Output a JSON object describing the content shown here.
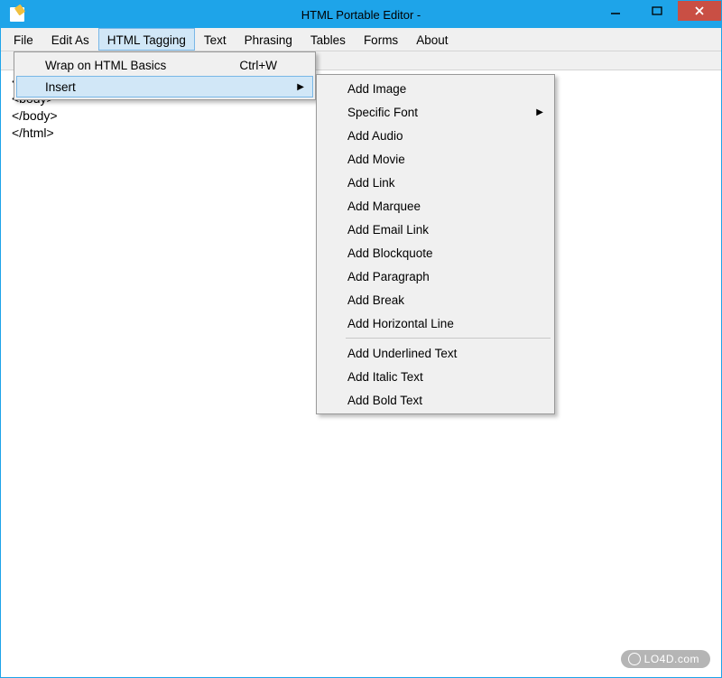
{
  "window": {
    "title": "HTML Portable Editor -"
  },
  "menubar": {
    "file": "File",
    "editas": "Edit As",
    "htmltagging": "HTML Tagging",
    "text": "Text",
    "phrasing": "Phrasing",
    "tables": "Tables",
    "forms": "Forms",
    "about": "About"
  },
  "dropdown": {
    "wrap": {
      "label": "Wrap on HTML Basics",
      "shortcut": "Ctrl+W"
    },
    "insert": {
      "label": "Insert"
    }
  },
  "submenu": {
    "addimage": "Add Image",
    "specificfont": "Specific Font",
    "addaudio": "Add Audio",
    "addmovie": "Add Movie",
    "addlink": "Add Link",
    "addmarquee": "Add Marquee",
    "addemail": "Add Email Link",
    "addblockquote": "Add Blockquote",
    "addparagraph": "Add Paragraph",
    "addbreak": "Add Break",
    "addhr": "Add Horizontal Line",
    "addunderlined": "Add Underlined Text",
    "additalic": "Add Italic Text",
    "addbold": "Add Bold Text"
  },
  "editor": {
    "line1": "</head>",
    "line2": "<body>",
    "line3": "",
    "line4": "</body>",
    "line5": "</html>"
  },
  "watermark": "LO4D.com"
}
